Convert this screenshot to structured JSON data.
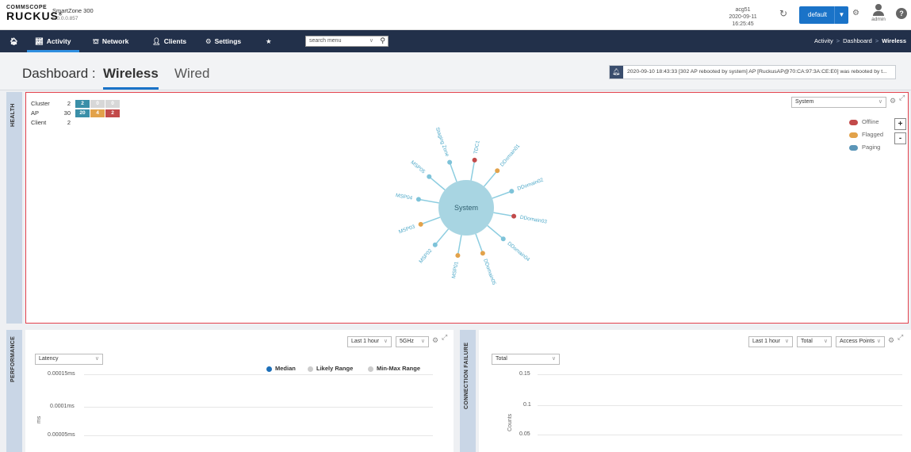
{
  "header": {
    "brand_top": "COMMSCOPE",
    "brand_main": "RUCKUS",
    "brand_mark": "®",
    "product_name": "SmartZone 300",
    "product_version": "6.0.0.0.857",
    "host": "acg51",
    "datetime": "2020-09-11 16:25:45",
    "domain_label": "default",
    "user": "admin",
    "help": "?"
  },
  "nav": {
    "items": [
      {
        "label": "Activity",
        "icon": "chart-line-icon"
      },
      {
        "label": "Network",
        "icon": "network-icon"
      },
      {
        "label": "Clients",
        "icon": "user-icon"
      },
      {
        "label": "Settings",
        "icon": "gear-icon"
      }
    ],
    "search_placeholder": "search menu",
    "breadcrumb": [
      "Activity",
      "Dashboard",
      "Wireless"
    ]
  },
  "title": {
    "prefix": "Dashboard :",
    "tab_wireless": "Wireless",
    "tab_wired": "Wired",
    "event_text": "2020-09-10 18:43:33 [302 AP rebooted by system] AP [RuckusAP@70:CA:97:3A:CE:E0] was rebooted by t..."
  },
  "health": {
    "tab_label": "HEALTH",
    "stats": [
      {
        "name": "Cluster",
        "count": "2",
        "badges": [
          "2",
          "0",
          "0"
        ]
      },
      {
        "name": "AP",
        "count": "30",
        "badges": [
          "20",
          "4",
          "2"
        ]
      },
      {
        "name": "Client",
        "count": "2",
        "badges": []
      }
    ],
    "scope_select": "System",
    "legend": [
      {
        "label": "Offline",
        "color": "#c24a4a"
      },
      {
        "label": "Flagged",
        "color": "#e2a24a"
      },
      {
        "label": "Paging",
        "color": "#5b96b8"
      }
    ],
    "zoom_in": "+",
    "zoom_out": "-",
    "center_label": "System",
    "nodes": [
      {
        "label": "TDC1",
        "status": "offline"
      },
      {
        "label": "DDomain01",
        "status": "flagged"
      },
      {
        "label": "DDomain02",
        "status": "paging"
      },
      {
        "label": "DDomain03",
        "status": "offline"
      },
      {
        "label": "DDomain04",
        "status": "paging"
      },
      {
        "label": "DDomain05",
        "status": "flagged"
      },
      {
        "label": "MSP01",
        "status": "flagged"
      },
      {
        "label": "MSP02",
        "status": "paging"
      },
      {
        "label": "MSP03",
        "status": "flagged"
      },
      {
        "label": "MSP04",
        "status": "paging"
      },
      {
        "label": "MSP05",
        "status": "paging"
      },
      {
        "label": "Staging Zone",
        "status": "paging"
      }
    ]
  },
  "performance": {
    "tab_label": "PERFORMANCE",
    "time_select": "Last 1 hour",
    "band_select": "5GHz",
    "metric_select": "Latency",
    "legend": [
      "Median",
      "Likely Range",
      "Min-Max Range"
    ],
    "y_ticks": [
      "0.00015ms",
      "0.0001ms",
      "0.00005ms"
    ],
    "y_unit": "ms"
  },
  "connection_failure": {
    "tab_label": "CONNECTION FAILURE",
    "time_select": "Last 1 hour",
    "type_select": "Total",
    "group_select": "Access Points",
    "metric_select": "Total",
    "y_ticks": [
      "0.15",
      "0.1",
      "0.05"
    ],
    "y_label": "Counts"
  }
}
